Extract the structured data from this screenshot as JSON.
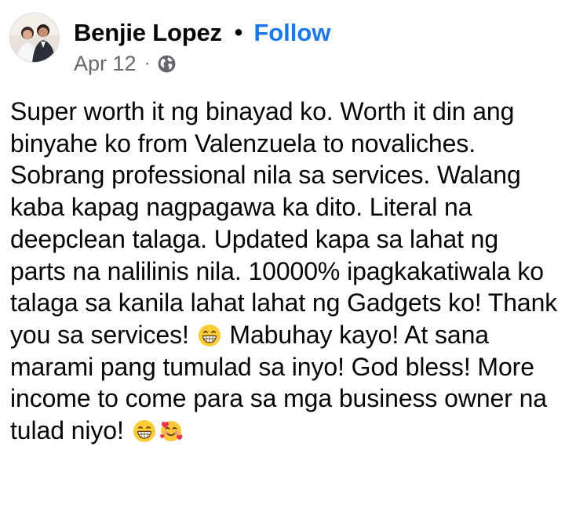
{
  "post": {
    "author": "Benjie Lopez",
    "separator": "•",
    "follow_label": "Follow",
    "date": "Apr 12",
    "date_separator": "·",
    "privacy_icon": "globe-icon",
    "text_part1": "Super worth it ng binayad ko. Worth it din ang binyahe ko from Valenzuela to novaliches. Sobrang professional nila sa services. Walang kaba kapag nagpagawa ka dito. Literal na deepclean talaga. Updated kapa sa lahat ng parts na nalilinis nila. 10000% ipagkakatiwala ko talaga sa kanila lahat lahat ng Gadgets ko! Thank you sa services! ",
    "emoji1": "😁",
    "text_part2": " Mabuhay kayo! At sana marami pang tumulad sa inyo! God bless! More income to come para sa mga business owner na tulad niyo! ",
    "emoji2": "😁",
    "emoji3": "🥰"
  },
  "colors": {
    "text": "#050505",
    "link": "#1877f2",
    "secondary": "#65676b",
    "background": "#ffffff"
  }
}
